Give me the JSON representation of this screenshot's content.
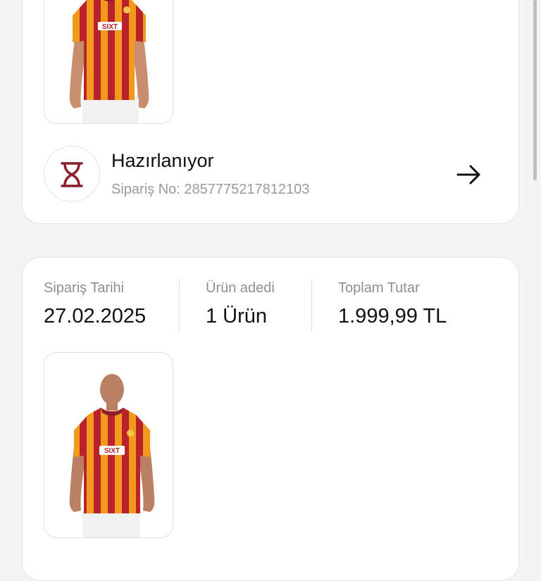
{
  "order_card_1": {
    "status_title": "Hazırlanıyor",
    "order_no_label": "Sipariş No:",
    "order_no_value": "2857775217812103",
    "status_icon": "hourglass-icon",
    "arrow_icon": "arrow-right-icon",
    "product_image": "galatasaray-jersey"
  },
  "order_card_2": {
    "order_date_label": "Sipariş Tarihi",
    "order_date_value": "27.02.2025",
    "item_count_label": "Ürün adedi",
    "item_count_value": "1 Ürün",
    "total_label": "Toplam Tutar",
    "total_value": "1.999,99 TL",
    "product_image": "galatasaray-jersey"
  },
  "colors": {
    "background": "#f4f4f4",
    "card": "#ffffff",
    "accent_maroon": "#8b1d2c",
    "jersey_red": "#b8232b",
    "jersey_orange": "#f39a1e",
    "muted_text": "#9a9a9a"
  }
}
